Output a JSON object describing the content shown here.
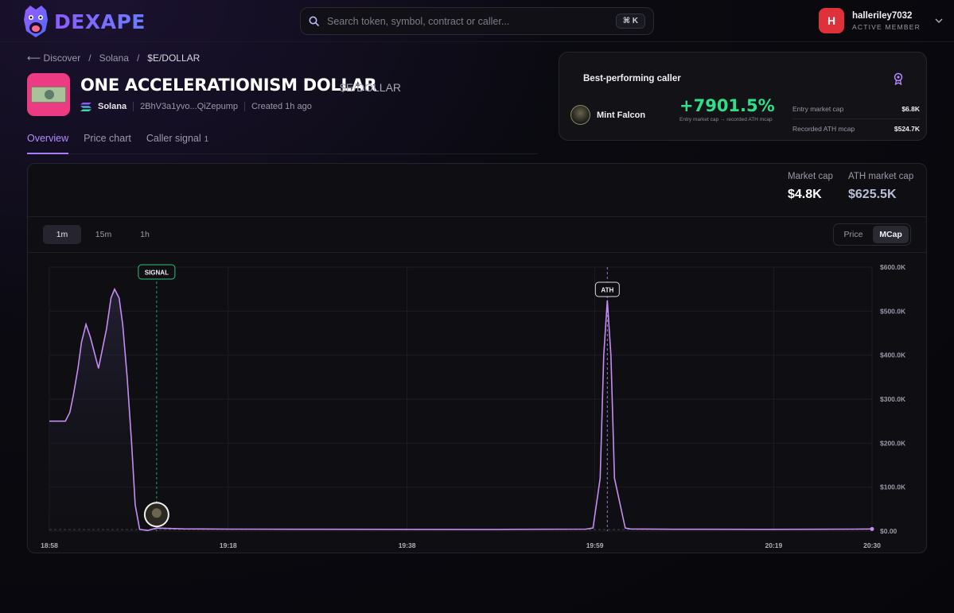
{
  "brand": {
    "name": "DEXAPE"
  },
  "search": {
    "placeholder": "Search token, symbol, contract or caller...",
    "shortcut": "⌘ K"
  },
  "user": {
    "initial": "H",
    "username": "halleriley7032",
    "role": "ACTIVE MEMBER"
  },
  "breadcrumb": {
    "back": "⟵ Discover",
    "sep1": "/",
    "chain": "Solana",
    "sep2": "/",
    "current": "$E/DOLLAR"
  },
  "token": {
    "name": "ONE ACCELERATIONISM DOLLAR",
    "symbol": "$E/DOLLAR",
    "chain": "Solana",
    "contract": "2BhV3a1yvo...QiZepump",
    "created": "Created 1h ago"
  },
  "tabs": [
    {
      "label": "Overview"
    },
    {
      "label": "Price chart"
    },
    {
      "label": "Caller signal",
      "count": "1"
    }
  ],
  "best_caller": {
    "title": "Best-performing caller",
    "name": "Mint Falcon",
    "gain": "+7901.5%",
    "gain_note": "Entry market cap → recorded ATH mcap",
    "entry_label": "Entry market cap",
    "entry_value": "$6.8K",
    "ath_label": "Recorded ATH mcap",
    "ath_value": "$524.7K"
  },
  "stats": {
    "market_cap_label": "Market cap",
    "market_cap_value": "$4.8K",
    "ath_label": "ATH market cap",
    "ath_value": "$625.5K"
  },
  "timeframes": [
    "1m",
    "15m",
    "1h"
  ],
  "active_timeframe": "1m",
  "modes": [
    "Price",
    "MCap"
  ],
  "active_mode": "MCap",
  "colors": {
    "accent": "#a97cf8",
    "gain": "#2fe08a",
    "line": "#c48df0",
    "signal": "#2fbf7a"
  },
  "chart_data": {
    "type": "line",
    "ylabel": "",
    "xlabel": "",
    "ylim": [
      0,
      600000
    ],
    "y_ticks": [
      "$600.0K",
      "$500.0K",
      "$400.0K",
      "$300.0K",
      "$200.0K",
      "$100.0K",
      "$0.00"
    ],
    "x_ticks": [
      "18:58",
      "19:18",
      "19:38",
      "19:59",
      "20:19",
      "20:30"
    ],
    "x_tick_minutes": [
      0,
      20,
      40,
      61,
      81,
      92
    ],
    "x_range_minutes": [
      0,
      92
    ],
    "grid": true,
    "series": [
      {
        "values_x_minutes": [
          0,
          0.9,
          1.8,
          2.3,
          2.7,
          3.2,
          3.6,
          4.1,
          4.6,
          5.5,
          6.4,
          6.9,
          7.3,
          7.8,
          8.2,
          8.7,
          9.2,
          9.6,
          10.1,
          11,
          12,
          15,
          20,
          30,
          40,
          50,
          60,
          60.8,
          61.6,
          62,
          62.4,
          62.8,
          63.2,
          64.4,
          65,
          70,
          80,
          90,
          92
        ],
        "values_y": [
          250000,
          250000,
          250000,
          270000,
          310000,
          370000,
          430000,
          470000,
          440000,
          370000,
          460000,
          530000,
          550000,
          530000,
          470000,
          350000,
          200000,
          60000,
          4000,
          1500,
          6800,
          5000,
          4500,
          4200,
          4000,
          3800,
          4500,
          7000,
          120000,
          400000,
          524700,
          400000,
          120000,
          7000,
          4800,
          4200,
          4000,
          4500,
          4800
        ]
      }
    ],
    "annotations": [
      {
        "label": "SIGNAL",
        "x_minutes": 12,
        "y": 6800
      },
      {
        "label": "ATH",
        "x_minutes": 62.4,
        "y": 524700
      }
    ]
  }
}
